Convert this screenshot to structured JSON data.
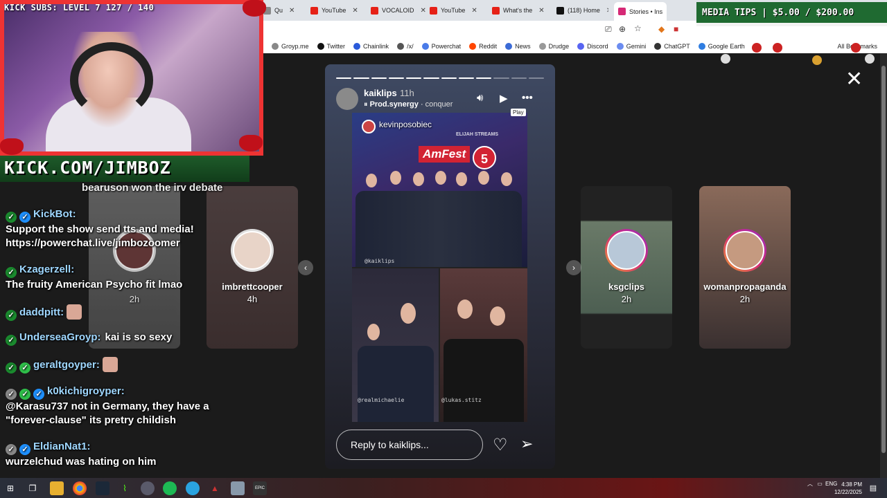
{
  "browser": {
    "tabs": [
      {
        "label": "Qu",
        "favicon_color": "#888888",
        "active": false
      },
      {
        "label": "YouTube",
        "favicon_color": "#e62117",
        "active": false
      },
      {
        "label": "VOCALOID",
        "favicon_color": "#e62117",
        "active": false
      },
      {
        "label": "YouTube",
        "favicon_color": "#e62117",
        "active": false
      },
      {
        "label": "What's the",
        "favicon_color": "#e62117",
        "active": false
      },
      {
        "label": "(118) Home",
        "favicon_color": "#111111",
        "active": false
      },
      {
        "label": "Stories • Ins",
        "favicon_color": "#d62976",
        "active": true
      }
    ],
    "bookmarks": [
      {
        "label": "Groyp.me",
        "icon": "groyp-icon",
        "color": "#888888"
      },
      {
        "label": "Twitter",
        "icon": "x-icon",
        "color": "#111111"
      },
      {
        "label": "Chainlink",
        "icon": "chainlink-icon",
        "color": "#2a5ada"
      },
      {
        "label": "/x/",
        "icon": "board-icon",
        "color": "#555555"
      },
      {
        "label": "Powerchat",
        "icon": "powerchat-icon",
        "color": "#4a7be8"
      },
      {
        "label": "Reddit",
        "icon": "reddit-icon",
        "color": "#ff4500"
      },
      {
        "label": "News",
        "icon": "news-icon",
        "color": "#3b6bd6"
      },
      {
        "label": "Drudge",
        "icon": "drudge-icon",
        "color": "#999999"
      },
      {
        "label": "Discord",
        "icon": "discord-icon",
        "color": "#5865f2"
      },
      {
        "label": "Gemini",
        "icon": "gemini-icon",
        "color": "#6b8cf0"
      },
      {
        "label": "ChatGPT",
        "icon": "chatgpt-icon",
        "color": "#333333"
      },
      {
        "label": "Google Earth",
        "icon": "earth-icon",
        "color": "#2f7de1"
      }
    ],
    "all_bookmarks_label": "All Bookmarks"
  },
  "overlay": {
    "subs_label": "KICK SUBS: LEVEL 7 127 / 140",
    "cam_url": "KICK.COM/JIMBOZ",
    "media_tips": "MEDIA TIPS | $5.00 / $200.00"
  },
  "chat": [
    {
      "user": "",
      "text": "bearuson won the irv debate",
      "badges": [],
      "layout": "partial"
    },
    {
      "user": "KickBot:",
      "text": "Support the show send tts and media! https://powerchat.live/jimbozoomer",
      "badges": [
        "#1a8a2e",
        "#1e90ff"
      ],
      "layout": "block"
    },
    {
      "user": "Kzagerzell:",
      "text": "The fruity American Psycho fit lmao",
      "badges": [
        "#1a8a2e"
      ],
      "layout": "block"
    },
    {
      "user": "daddpitt:",
      "text": "",
      "badges": [
        "#1a8a2e"
      ],
      "emote": true,
      "layout": "inline"
    },
    {
      "user": "UnderseaGroyp:",
      "text": "kai is so sexy",
      "badges": [
        "#1a8a2e"
      ],
      "layout": "inline"
    },
    {
      "user": "geraltgoyper:",
      "text": "",
      "badges": [
        "#1a8a2e",
        "#2fbf4a"
      ],
      "emote": true,
      "layout": "inline"
    },
    {
      "user": "k0kichigroyper:",
      "text": "@Karasu737 not in Germany, they have a \"forever-clause\" its pretry childish",
      "badges": [
        "#888888",
        "#2fbf4a",
        "#1e90ff"
      ],
      "layout": "block"
    },
    {
      "user": "EldianNat1:",
      "text": "wurzelchud was hating on him",
      "badges": [
        "#888888",
        "#1e90ff"
      ],
      "layout": "block"
    }
  ],
  "stories": {
    "left": [
      {
        "name": "",
        "time": "2h",
        "ring": "#dddddd",
        "bg": "#5a5a5a"
      },
      {
        "name": "imbrettcooper",
        "time": "4h",
        "ring": "#dddddd",
        "bg": "#4a3d3d"
      }
    ],
    "right": [
      {
        "name": "ksgclips",
        "time": "2h",
        "ring": "#d62976",
        "bg": "#5a6b5a"
      },
      {
        "name": "womanpropaganda",
        "time": "2h",
        "ring": "#f0a030",
        "bg": "#6a4a3a"
      }
    ],
    "current": {
      "user": "kaiklips",
      "time": "11h",
      "music_artist": "Prod.synergy",
      "music_song": "conquer",
      "segments_total": 12,
      "segments_done": 9,
      "play_tooltip": "Play",
      "collage_user": "kevinposobiec",
      "amfest_label": "AmFest",
      "amfest_number": "5",
      "sign_text": "ELIJAH STREAMS",
      "tag_top": "@kaiklips",
      "tag_bl": "@realmichaelie",
      "tag_br": "@lukas.stitz",
      "reply_placeholder": "Reply to kaiklips..."
    }
  },
  "taskbar": {
    "lang": "ENG",
    "time": "4:38 PM",
    "date": "12/22/2025"
  }
}
